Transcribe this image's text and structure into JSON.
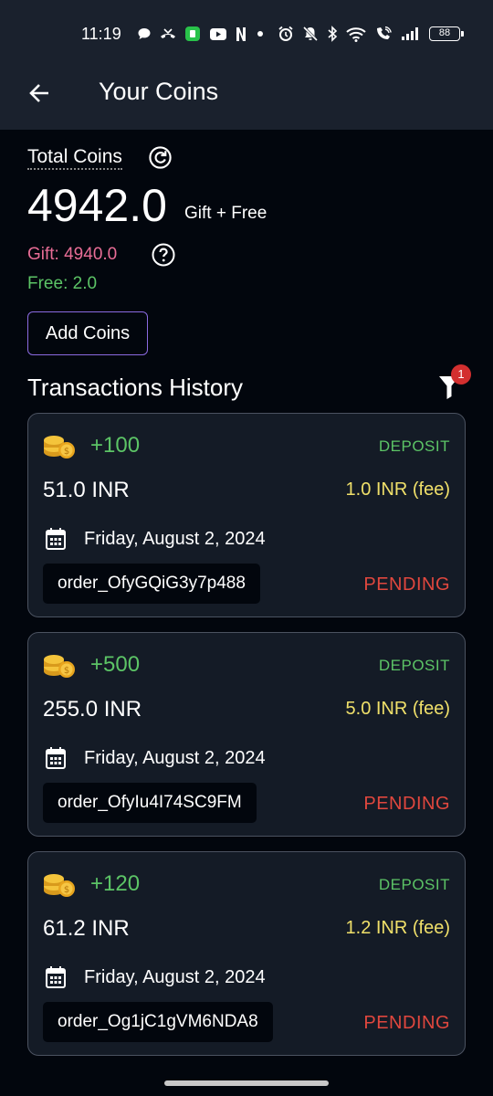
{
  "status_bar": {
    "time": "11:19",
    "battery": "88",
    "icons": [
      "chat-bubble-icon",
      "missed-call-icon",
      "app-notification-icon",
      "youtube-icon",
      "netflix-icon",
      "dot-icon",
      "alarm-icon",
      "mute-icon",
      "bluetooth-icon",
      "wifi-icon",
      "wifi-calling-icon",
      "signal-icon",
      "battery-icon"
    ]
  },
  "app_bar": {
    "title": "Your Coins",
    "back_icon": "arrow-left-icon"
  },
  "summary": {
    "total_label": "Total Coins",
    "total_value": "4942.0",
    "total_suffix": "Gift + Free",
    "gift": "Gift: 4940.0",
    "free": "Free: 2.0",
    "add_coins_label": "Add Coins"
  },
  "history": {
    "title": "Transactions History",
    "filter_badge": "1",
    "transactions": [
      {
        "amount": "+100",
        "type": "DEPOSIT",
        "inr": "51.0 INR",
        "fee": "1.0 INR (fee)",
        "date": "Friday, August 2, 2024",
        "order_id": "order_OfyGQiG3y7p488",
        "status": "PENDING"
      },
      {
        "amount": "+500",
        "type": "DEPOSIT",
        "inr": "255.0 INR",
        "fee": "5.0 INR (fee)",
        "date": "Friday, August 2, 2024",
        "order_id": "order_OfyIu4I74SC9FM",
        "status": "PENDING"
      },
      {
        "amount": "+120",
        "type": "DEPOSIT",
        "inr": "61.2 INR",
        "fee": "1.2 INR (fee)",
        "date": "Friday, August 2, 2024",
        "order_id": "order_Og1jC1gVM6NDA8",
        "status": "PENDING"
      }
    ]
  },
  "colors": {
    "background": "#02060d",
    "app_bar": "#1a212d",
    "card": "#141b26",
    "green": "#5cc466",
    "gift_pink": "#e86d96",
    "fee_yellow": "#f0e06a",
    "pending_red": "#e0473e",
    "button_border": "#8a6ae0",
    "badge_red": "#d32f2f"
  }
}
